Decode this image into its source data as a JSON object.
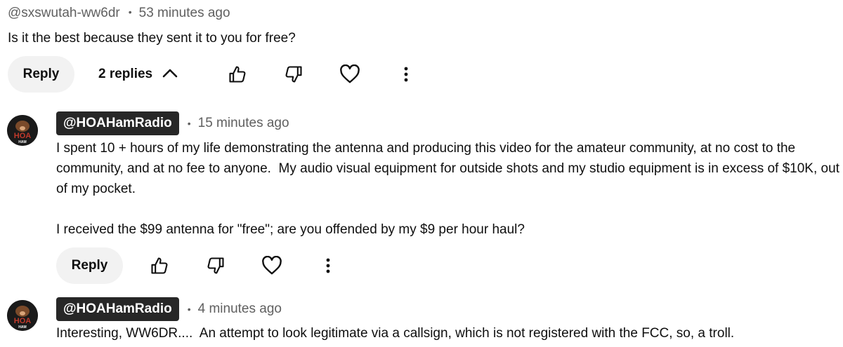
{
  "top_comment": {
    "handle": "@sxswutah-ww6dr",
    "time": "53 minutes ago",
    "text": "Is it the best because they sent it to you for free?",
    "reply_label": "Reply",
    "replies_label": "2 replies"
  },
  "replies": [
    {
      "handle": "@HOAHamRadio",
      "time": "15 minutes ago",
      "paragraph1_line1": "I spent 10 + hours of my life demonstrating the antenna and producing this video for the amateur community, at no cost to the",
      "paragraph1_line2": "community, and at no fee to anyone.  My audio visual equipment for outside shots and my studio equipment is in excess of $10K, out",
      "paragraph1_line3": "of my pocket.",
      "paragraph2": "I received the $99 antenna for \"free\"; are you offended by my $9 per hour haul?",
      "reply_label": "Reply",
      "avatar_text": "HOA",
      "avatar_sub": "HAM"
    },
    {
      "handle": "@HOAHamRadio",
      "time": "4 minutes ago",
      "text": "Interesting, WW6DR....  An attempt to look legitimate via a callsign, which is not registered with the FCC, so, a troll.",
      "avatar_text": "HOA",
      "avatar_sub": "HAM"
    }
  ],
  "icons": {
    "like": "thumbs-up-icon",
    "dislike": "thumbs-down-icon",
    "heart": "heart-icon",
    "more": "more-vert-icon",
    "collapse": "chevron-up-icon"
  },
  "colors": {
    "chip_bg": "#272727",
    "reply_bg": "#f2f2f2",
    "meta": "#606060",
    "avatar_accent": "#c0392b"
  }
}
